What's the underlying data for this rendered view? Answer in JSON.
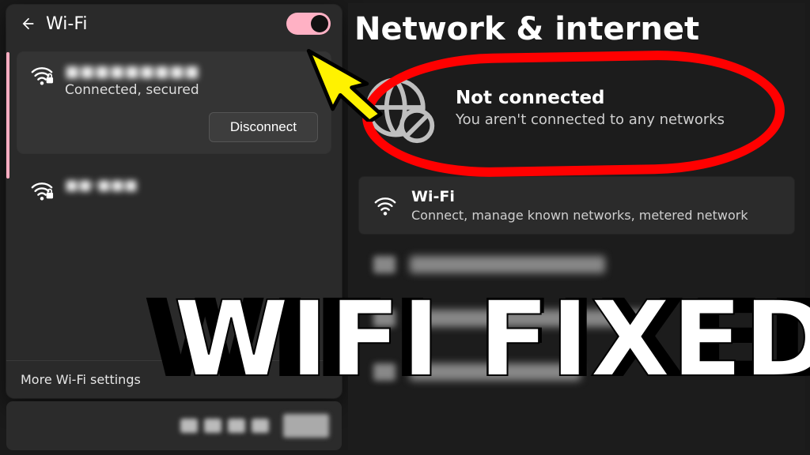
{
  "left": {
    "title": "Wi-Fi",
    "connected": {
      "ssid": "■■■■■■■■■",
      "status": "Connected, secured",
      "button": "Disconnect"
    },
    "other_network": {
      "ssid": "■■·■■■"
    },
    "more_settings": "More Wi-Fi settings"
  },
  "right": {
    "title": "Network & internet",
    "not_connected": {
      "heading": "Not connected",
      "sub": "You aren't connected to any networks"
    },
    "wifi_row": {
      "heading": "Wi-Fi",
      "sub": "Connect, manage known networks, metered network"
    }
  },
  "banner": "WIFI FIXED"
}
